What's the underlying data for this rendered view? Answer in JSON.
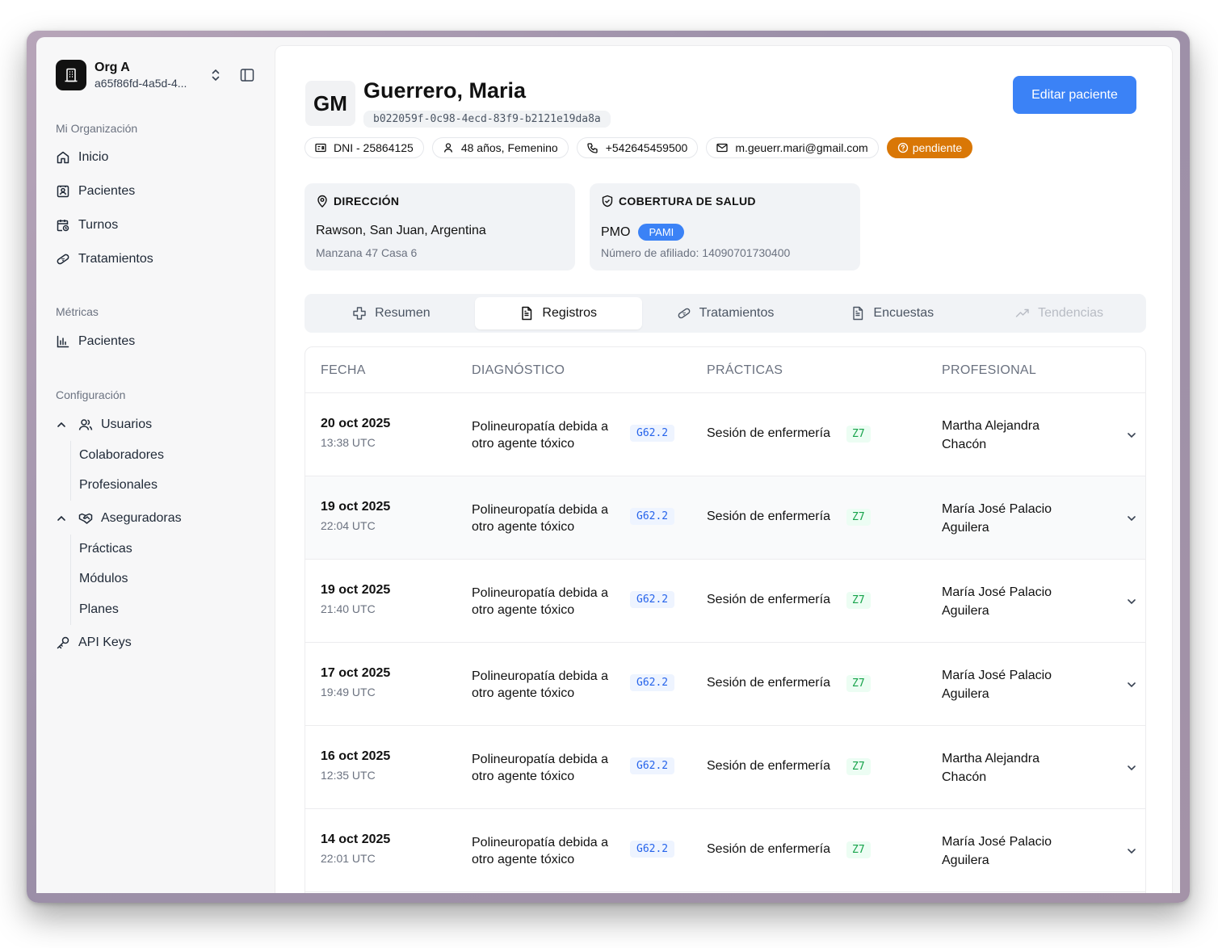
{
  "org": {
    "name": "Org A",
    "id": "a65f86fd-4a5d-4..."
  },
  "sidebar": {
    "section_org": "Mi Organización",
    "inicio": "Inicio",
    "pacientes": "Pacientes",
    "turnos": "Turnos",
    "tratamientos": "Tratamientos",
    "section_metricas": "Métricas",
    "metricas_pacientes": "Pacientes",
    "section_config": "Configuración",
    "usuarios": "Usuarios",
    "colaboradores": "Colaboradores",
    "profesionales": "Profesionales",
    "aseguradoras": "Aseguradoras",
    "practicas": "Prácticas",
    "modulos": "Módulos",
    "planes": "Planes",
    "api_keys": "API Keys"
  },
  "patient": {
    "initials": "GM",
    "name": "Guerrero, Maria",
    "id": "b022059f-0c98-4ecd-83f9-b2121e19da8a",
    "dni": "DNI - 25864125",
    "age_gender": "48 años, Femenino",
    "phone": "+542645459500",
    "email": "m.geuerr.mari@gmail.com",
    "status": "pendiente",
    "status_color": "#d97706"
  },
  "actions": {
    "edit": "Editar paciente",
    "accent": "#3b82f6"
  },
  "address": {
    "title": "DIRECCIÓN",
    "main": "Rawson, San Juan, Argentina",
    "detail": "Manzana 47 Casa 6"
  },
  "coverage": {
    "title": "COBERTURA DE SALUD",
    "plan": "PMO",
    "badge": "PAMI",
    "affiliate": "Número de afiliado: 14090701730400"
  },
  "tabs": [
    {
      "label": "Resumen",
      "icon": "plus-icon",
      "state": "normal"
    },
    {
      "label": "Registros",
      "icon": "document-icon",
      "state": "active"
    },
    {
      "label": "Tratamientos",
      "icon": "bandage-icon",
      "state": "normal"
    },
    {
      "label": "Encuestas",
      "icon": "document-icon",
      "state": "normal"
    },
    {
      "label": "Tendencias",
      "icon": "trend-icon",
      "state": "disabled"
    }
  ],
  "table": {
    "headers": {
      "fecha": "FECHA",
      "diagnostico": "DIAGNÓSTICO",
      "practicas": "PRÁCTICAS",
      "profesional": "PROFESIONAL"
    },
    "rows": [
      {
        "date": "20 oct 2025",
        "time": "13:38 UTC",
        "diag": "Polineuropatía debida a otro agente tóxico",
        "diag_code": "G62.2",
        "practice": "Sesión de enfermería",
        "practice_code": "Z7",
        "professional": "Martha Alejandra Chacón"
      },
      {
        "date": "19 oct 2025",
        "time": "22:04 UTC",
        "diag": "Polineuropatía debida a otro agente tóxico",
        "diag_code": "G62.2",
        "practice": "Sesión de enfermería",
        "practice_code": "Z7",
        "professional": "María José Palacio Aguilera"
      },
      {
        "date": "19 oct 2025",
        "time": "21:40 UTC",
        "diag": "Polineuropatía debida a otro agente tóxico",
        "diag_code": "G62.2",
        "practice": "Sesión de enfermería",
        "practice_code": "Z7",
        "professional": "María José Palacio Aguilera"
      },
      {
        "date": "17 oct 2025",
        "time": "19:49 UTC",
        "diag": "Polineuropatía debida a otro agente tóxico",
        "diag_code": "G62.2",
        "practice": "Sesión de enfermería",
        "practice_code": "Z7",
        "professional": "María José Palacio Aguilera"
      },
      {
        "date": "16 oct 2025",
        "time": "12:35 UTC",
        "diag": "Polineuropatía debida a otro agente tóxico",
        "diag_code": "G62.2",
        "practice": "Sesión de enfermería",
        "practice_code": "Z7",
        "professional": "Martha Alejandra Chacón"
      },
      {
        "date": "14 oct 2025",
        "time": "22:01 UTC",
        "diag": "Polineuropatía debida a otro agente tóxico",
        "diag_code": "G62.2",
        "practice": "Sesión de enfermería",
        "practice_code": "Z7",
        "professional": "María José Palacio Aguilera"
      }
    ]
  }
}
